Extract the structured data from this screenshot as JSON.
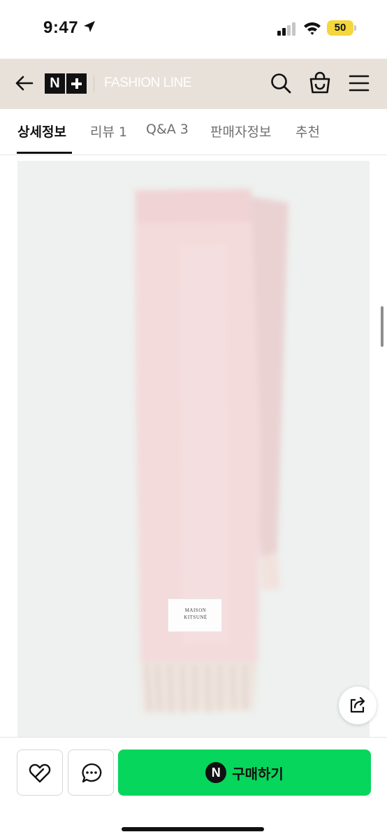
{
  "status_bar": {
    "time": "9:47",
    "battery_level": "50",
    "battery_color": "#f5d73b",
    "icons": [
      "location-arrow-icon",
      "cellular-signal-icon",
      "wifi-icon",
      "battery-icon"
    ]
  },
  "header": {
    "logo_text": "N",
    "brand_text": "FASHION LINE",
    "background": "#e8e1d9",
    "icons": [
      "back-arrow-icon",
      "search-icon",
      "shopping-bag-icon",
      "hamburger-menu-icon"
    ]
  },
  "tabs": [
    {
      "label": "상세정보",
      "active": true
    },
    {
      "label": "리뷰 1",
      "active": false
    },
    {
      "label": "Q&A 3",
      "active": false
    },
    {
      "label": "판매자정보",
      "active": false
    },
    {
      "label": "추천",
      "active": false
    }
  ],
  "product_image": {
    "label_lines": [
      "MAISON",
      "KITSUNÉ"
    ],
    "scarf_color": "#f1d9d9",
    "background": "#eef1ef",
    "share_icon": "share-icon"
  },
  "bottom_bar": {
    "buy_label": "구매하기",
    "pay_badge": "N",
    "buy_color": "#06d65c",
    "icons": [
      "heart-link-icon",
      "chat-bubble-icon"
    ]
  }
}
